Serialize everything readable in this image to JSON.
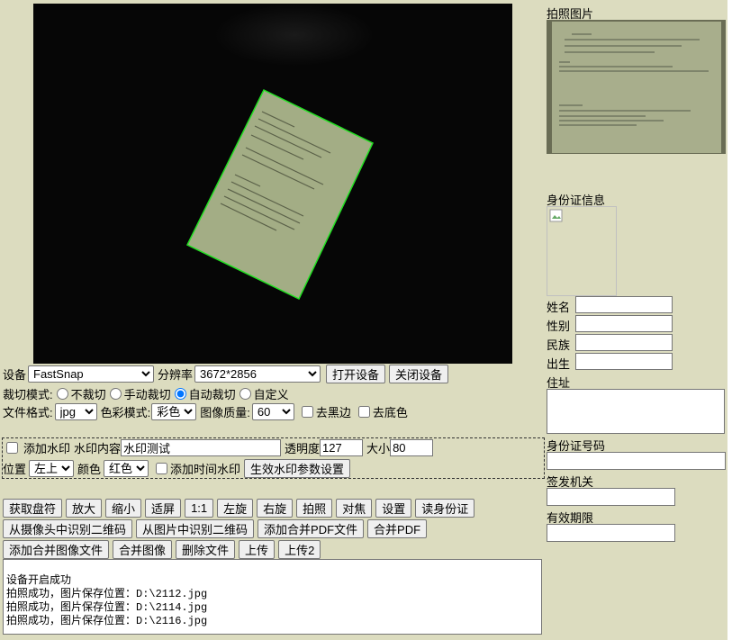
{
  "device": {
    "label": "设备",
    "value": "FastSnap",
    "resolution_label": "分辨率",
    "resolution_value": "3672*2856",
    "open_button": "打开设备",
    "close_button": "关闭设备"
  },
  "crop": {
    "label": "裁切模式:",
    "options": [
      "不裁切",
      "手动裁切",
      "自动裁切",
      "自定义"
    ],
    "selected": "自动裁切"
  },
  "format": {
    "file_label": "文件格式:",
    "file_value": "jpg",
    "color_label": "色彩模式:",
    "color_value": "彩色",
    "quality_label": "图像质量:",
    "quality_value": "60",
    "remove_border": "去黑边",
    "remove_bg": "去底色"
  },
  "watermark": {
    "add_label": "添加水印",
    "content_label": "水印内容",
    "content_value": "水印测试",
    "opacity_label": "透明度",
    "opacity_value": "127",
    "size_label": "大小",
    "size_value": "80",
    "position_label": "位置",
    "position_value": "左上",
    "color_label": "颜色",
    "color_value": "红色",
    "time_label": "添加时间水印",
    "apply_button": "生效水印参数设置"
  },
  "buttons": {
    "row1": [
      "获取盘符",
      "放大",
      "缩小",
      "适屏",
      "1:1",
      "左旋",
      "右旋",
      "拍照",
      "对焦",
      "设置",
      "读身份证"
    ],
    "row2": [
      "从摄像头中识别二维码",
      "从图片中识别二维码",
      "添加合并PDF文件",
      "合并PDF"
    ],
    "row3": [
      "添加合并图像文件",
      "合并图像",
      "删除文件",
      "上传",
      "上传2"
    ]
  },
  "log": {
    "lines": [
      "设备开启成功",
      "拍照成功，图片保存位置：D:\\2112.jpg",
      "拍照成功，图片保存位置：D:\\2114.jpg",
      "拍照成功，图片保存位置：D:\\2116.jpg"
    ]
  },
  "right": {
    "photo_title": "拍照图片",
    "id_title": "身份证信息",
    "name_label": "姓名",
    "gender_label": "性别",
    "ethnicity_label": "民族",
    "birth_label": "出生",
    "address_label": "住址",
    "id_number_label": "身份证号码",
    "issuer_label": "签发机关",
    "validity_label": "有效期限"
  },
  "colors": {
    "panel_bg": "#dcdcbf",
    "crop_outline": "#22e022"
  }
}
